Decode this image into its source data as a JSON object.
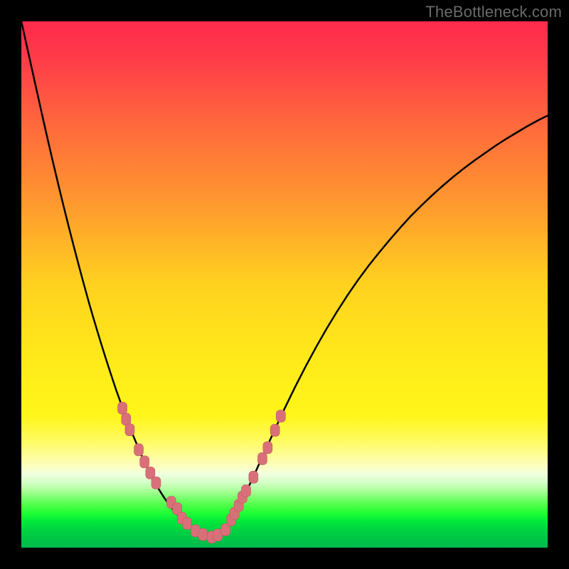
{
  "watermark": "TheBottleneck.com",
  "colors": {
    "frame": "#000000",
    "curve": "#000000",
    "marker_fill": "#d97079",
    "marker_stroke": "#c25761",
    "gradient_stops": [
      {
        "offset": 0.0,
        "color": "#ff2a4d"
      },
      {
        "offset": 0.07,
        "color": "#ff3b49"
      },
      {
        "offset": 0.2,
        "color": "#ff6a3c"
      },
      {
        "offset": 0.35,
        "color": "#ff9a2e"
      },
      {
        "offset": 0.5,
        "color": "#ffd21f"
      },
      {
        "offset": 0.63,
        "color": "#ffe81a"
      },
      {
        "offset": 0.75,
        "color": "#fff61a"
      },
      {
        "offset": 0.8,
        "color": "#fffb66"
      },
      {
        "offset": 0.845,
        "color": "#fdfec0"
      },
      {
        "offset": 0.86,
        "color": "#f1ffe0"
      },
      {
        "offset": 0.875,
        "color": "#d6ffc8"
      },
      {
        "offset": 0.89,
        "color": "#b0ffa0"
      },
      {
        "offset": 0.905,
        "color": "#7dff70"
      },
      {
        "offset": 0.92,
        "color": "#4cff47"
      },
      {
        "offset": 0.935,
        "color": "#1eff34"
      },
      {
        "offset": 0.95,
        "color": "#00e83a"
      },
      {
        "offset": 0.97,
        "color": "#00d043"
      },
      {
        "offset": 1.0,
        "color": "#00b94a"
      }
    ]
  },
  "chart_data": {
    "type": "line",
    "title": "",
    "xlabel": "",
    "ylabel": "",
    "xlim": [
      0,
      100
    ],
    "ylim": [
      0,
      100
    ],
    "x": [
      0,
      1,
      2,
      3,
      4,
      5,
      6,
      7,
      8,
      9,
      10,
      11,
      12,
      13,
      14,
      15,
      16,
      17,
      18,
      19,
      20,
      21,
      22,
      23,
      24,
      25,
      26,
      27,
      28,
      29,
      30,
      31,
      32,
      33,
      34,
      35,
      36,
      37,
      38,
      39,
      40,
      41,
      42,
      43,
      44,
      45,
      46,
      48,
      50,
      52,
      54,
      56,
      58,
      60,
      62,
      64,
      66,
      68,
      70,
      72,
      74,
      76,
      78,
      80,
      82,
      84,
      86,
      88,
      90,
      92,
      94,
      96,
      98,
      100
    ],
    "series": [
      {
        "name": "bottleneck-curve",
        "values": [
          100.0,
          95.5,
          91.0,
          86.5,
          82.0,
          77.6,
          73.3,
          69.1,
          65.0,
          61.0,
          57.1,
          53.3,
          49.6,
          46.0,
          42.6,
          39.3,
          36.1,
          33.0,
          30.0,
          27.2,
          24.5,
          21.9,
          19.5,
          17.2,
          15.1,
          13.1,
          11.3,
          9.7,
          8.3,
          7.0,
          5.9,
          5.0,
          4.2,
          3.5,
          2.9,
          2.4,
          2.1,
          2.3,
          3.0,
          4.1,
          5.6,
          7.3,
          9.2,
          11.2,
          13.3,
          15.5,
          17.7,
          22.1,
          26.4,
          30.5,
          34.4,
          38.1,
          41.6,
          44.9,
          48.0,
          50.9,
          53.6,
          56.1,
          58.5,
          60.8,
          63.0,
          65.0,
          66.9,
          68.7,
          70.4,
          72.0,
          73.5,
          74.9,
          76.3,
          77.6,
          78.8,
          80.0,
          81.1,
          82.1
        ]
      }
    ],
    "markers": {
      "name": "highlighted-points",
      "style": "rounded-rect",
      "points": [
        {
          "x": 19.2,
          "y": 26.5
        },
        {
          "x": 19.9,
          "y": 24.4
        },
        {
          "x": 20.6,
          "y": 22.4
        },
        {
          "x": 22.3,
          "y": 18.6
        },
        {
          "x": 23.4,
          "y": 16.3
        },
        {
          "x": 24.5,
          "y": 14.2
        },
        {
          "x": 25.6,
          "y": 12.3
        },
        {
          "x": 28.5,
          "y": 8.6
        },
        {
          "x": 29.6,
          "y": 7.4
        },
        {
          "x": 30.5,
          "y": 5.6
        },
        {
          "x": 31.5,
          "y": 4.6
        },
        {
          "x": 33.1,
          "y": 3.2
        },
        {
          "x": 34.5,
          "y": 2.5
        },
        {
          "x": 36.2,
          "y": 2.0
        },
        {
          "x": 37.3,
          "y": 2.4
        },
        {
          "x": 38.8,
          "y": 3.4
        },
        {
          "x": 39.9,
          "y": 5.3
        },
        {
          "x": 40.5,
          "y": 6.5
        },
        {
          "x": 41.3,
          "y": 8.0
        },
        {
          "x": 42.0,
          "y": 9.6
        },
        {
          "x": 42.7,
          "y": 10.8
        },
        {
          "x": 44.1,
          "y": 13.4
        },
        {
          "x": 45.8,
          "y": 16.9
        },
        {
          "x": 46.8,
          "y": 19.0
        },
        {
          "x": 48.2,
          "y": 22.3
        },
        {
          "x": 49.3,
          "y": 25.0
        }
      ]
    }
  }
}
